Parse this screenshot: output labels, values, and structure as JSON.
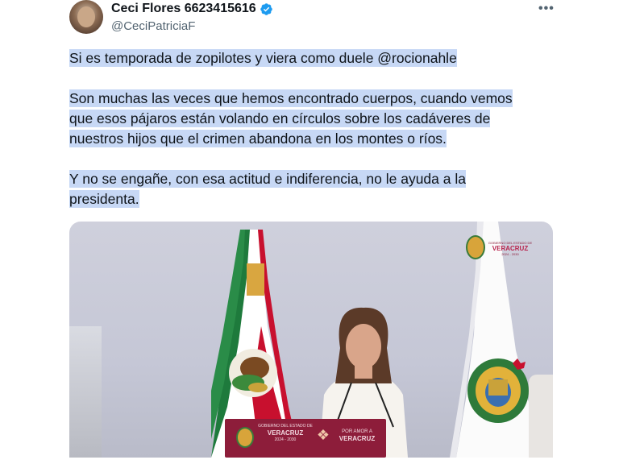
{
  "author": {
    "name": "Ceci Flores 6623415616",
    "handle": "@CeciPatriciaF"
  },
  "icons": {
    "verified": "verified-badge-icon",
    "more": "more-options-icon"
  },
  "colors": {
    "verified": "#1d9bf0",
    "highlight": "#c7d8f5",
    "text": "#0f1419",
    "secondary": "#536471"
  },
  "tweet": {
    "line1": "Si es temporada de zopilotes y viera como duele @rocionahle",
    "line2": "Son muchas las veces que hemos encontrado cuerpos, cuando vemos",
    "line3": "que esos pájaros están volando en círculos sobre los cadáveres de",
    "line4": "nuestros hijos que el crimen abandona en los montes o ríos.",
    "line5": "Y no se engañe, con esa actitud e indiferencia, no le ayuda a la",
    "line6": "presidenta."
  },
  "media": {
    "logo_top": "GOBIERNO DEL ESTADO DE",
    "logo_name": "VERACRUZ",
    "logo_years": "2024 - 2030",
    "podium_left_top": "GOBIERNO DEL ESTADO DE",
    "podium_left_name": "VERACRUZ",
    "podium_left_years": "2024 - 2030",
    "podium_right_top": "POR AMOR A",
    "podium_right_name": "VERACRUZ"
  }
}
